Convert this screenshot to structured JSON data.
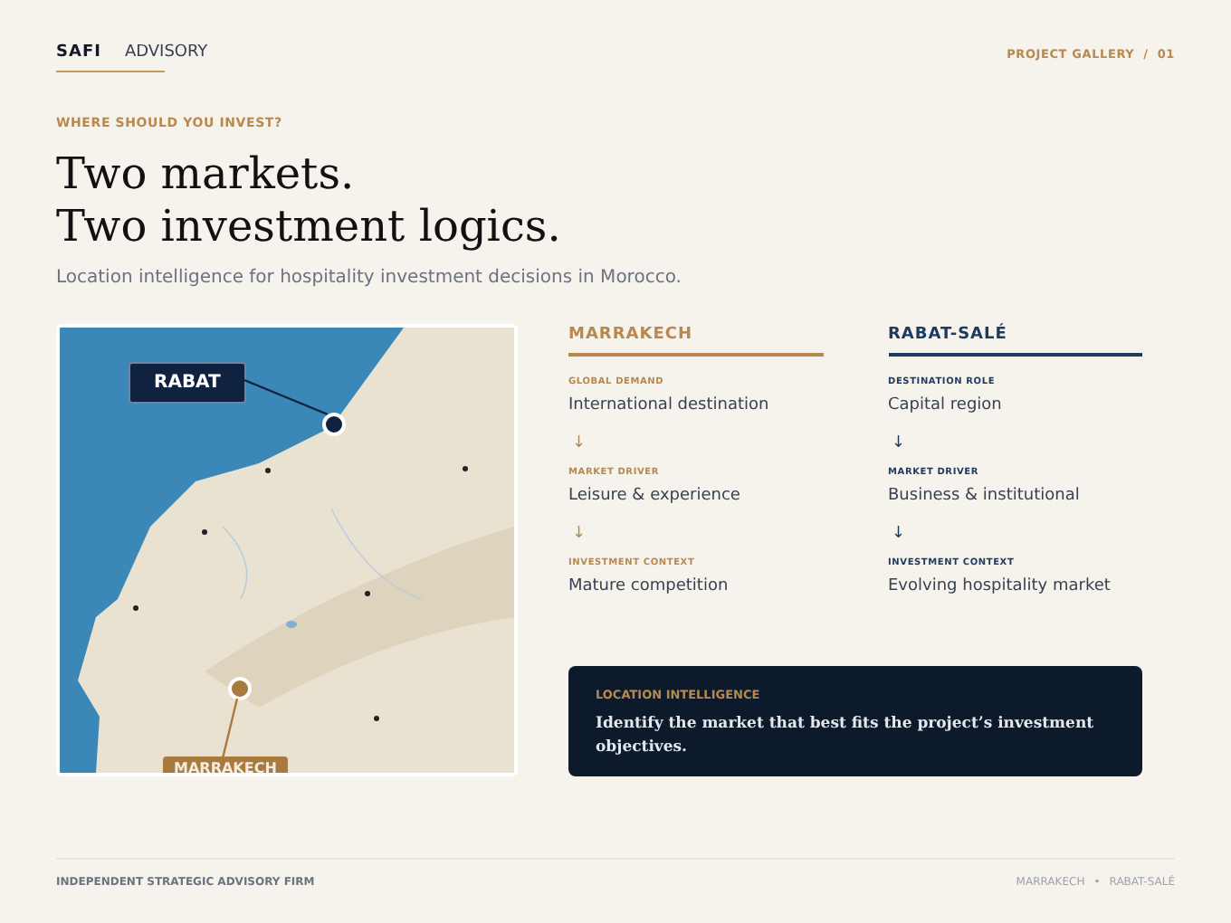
{
  "brand": {
    "name": "SAFI",
    "suffix": "ADVISORY"
  },
  "gallery": {
    "label": "PROJECT GALLERY",
    "separator": "/",
    "number": "01"
  },
  "eyebrow": "WHERE SHOULD YOU INVEST?",
  "title_lines": [
    "Two markets.",
    "Two investment logics."
  ],
  "subtitle": "Location intelligence for hospitality investment decisions in Morocco.",
  "map": {
    "pins": [
      {
        "label": "RABAT",
        "color": "#0f2340"
      },
      {
        "label": "MARRAKECH",
        "color": "#a87a3c"
      }
    ]
  },
  "markets": [
    {
      "name": "MARRAKECH",
      "color": "#b8894f",
      "steps": [
        {
          "label": "GLOBAL DEMAND",
          "value": "International destination",
          "arrow": "↓"
        },
        {
          "label": "MARKET DRIVER",
          "value": "Leisure & experience",
          "arrow": "↓"
        },
        {
          "label": "INVESTMENT CONTEXT",
          "value": "Mature competition"
        }
      ]
    },
    {
      "name": "RABAT-SALÉ",
      "color": "#1d3a5f",
      "steps": [
        {
          "label": "DESTINATION ROLE",
          "value": "Capital region",
          "arrow": "↓"
        },
        {
          "label": "MARKET DRIVER",
          "value": "Business & institutional",
          "arrow": "↓"
        },
        {
          "label": "INVESTMENT CONTEXT",
          "value": "Evolving hospitality market"
        }
      ]
    }
  ],
  "callout": {
    "label": "LOCATION INTELLIGENCE",
    "text": "Identify the market that best fits the project’s investment objectives."
  },
  "footer": {
    "left": "INDEPENDENT STRATEGIC ADVISORY FIRM",
    "right": [
      "MARRAKECH",
      "RABAT-SALÉ"
    ],
    "separator": "•"
  }
}
